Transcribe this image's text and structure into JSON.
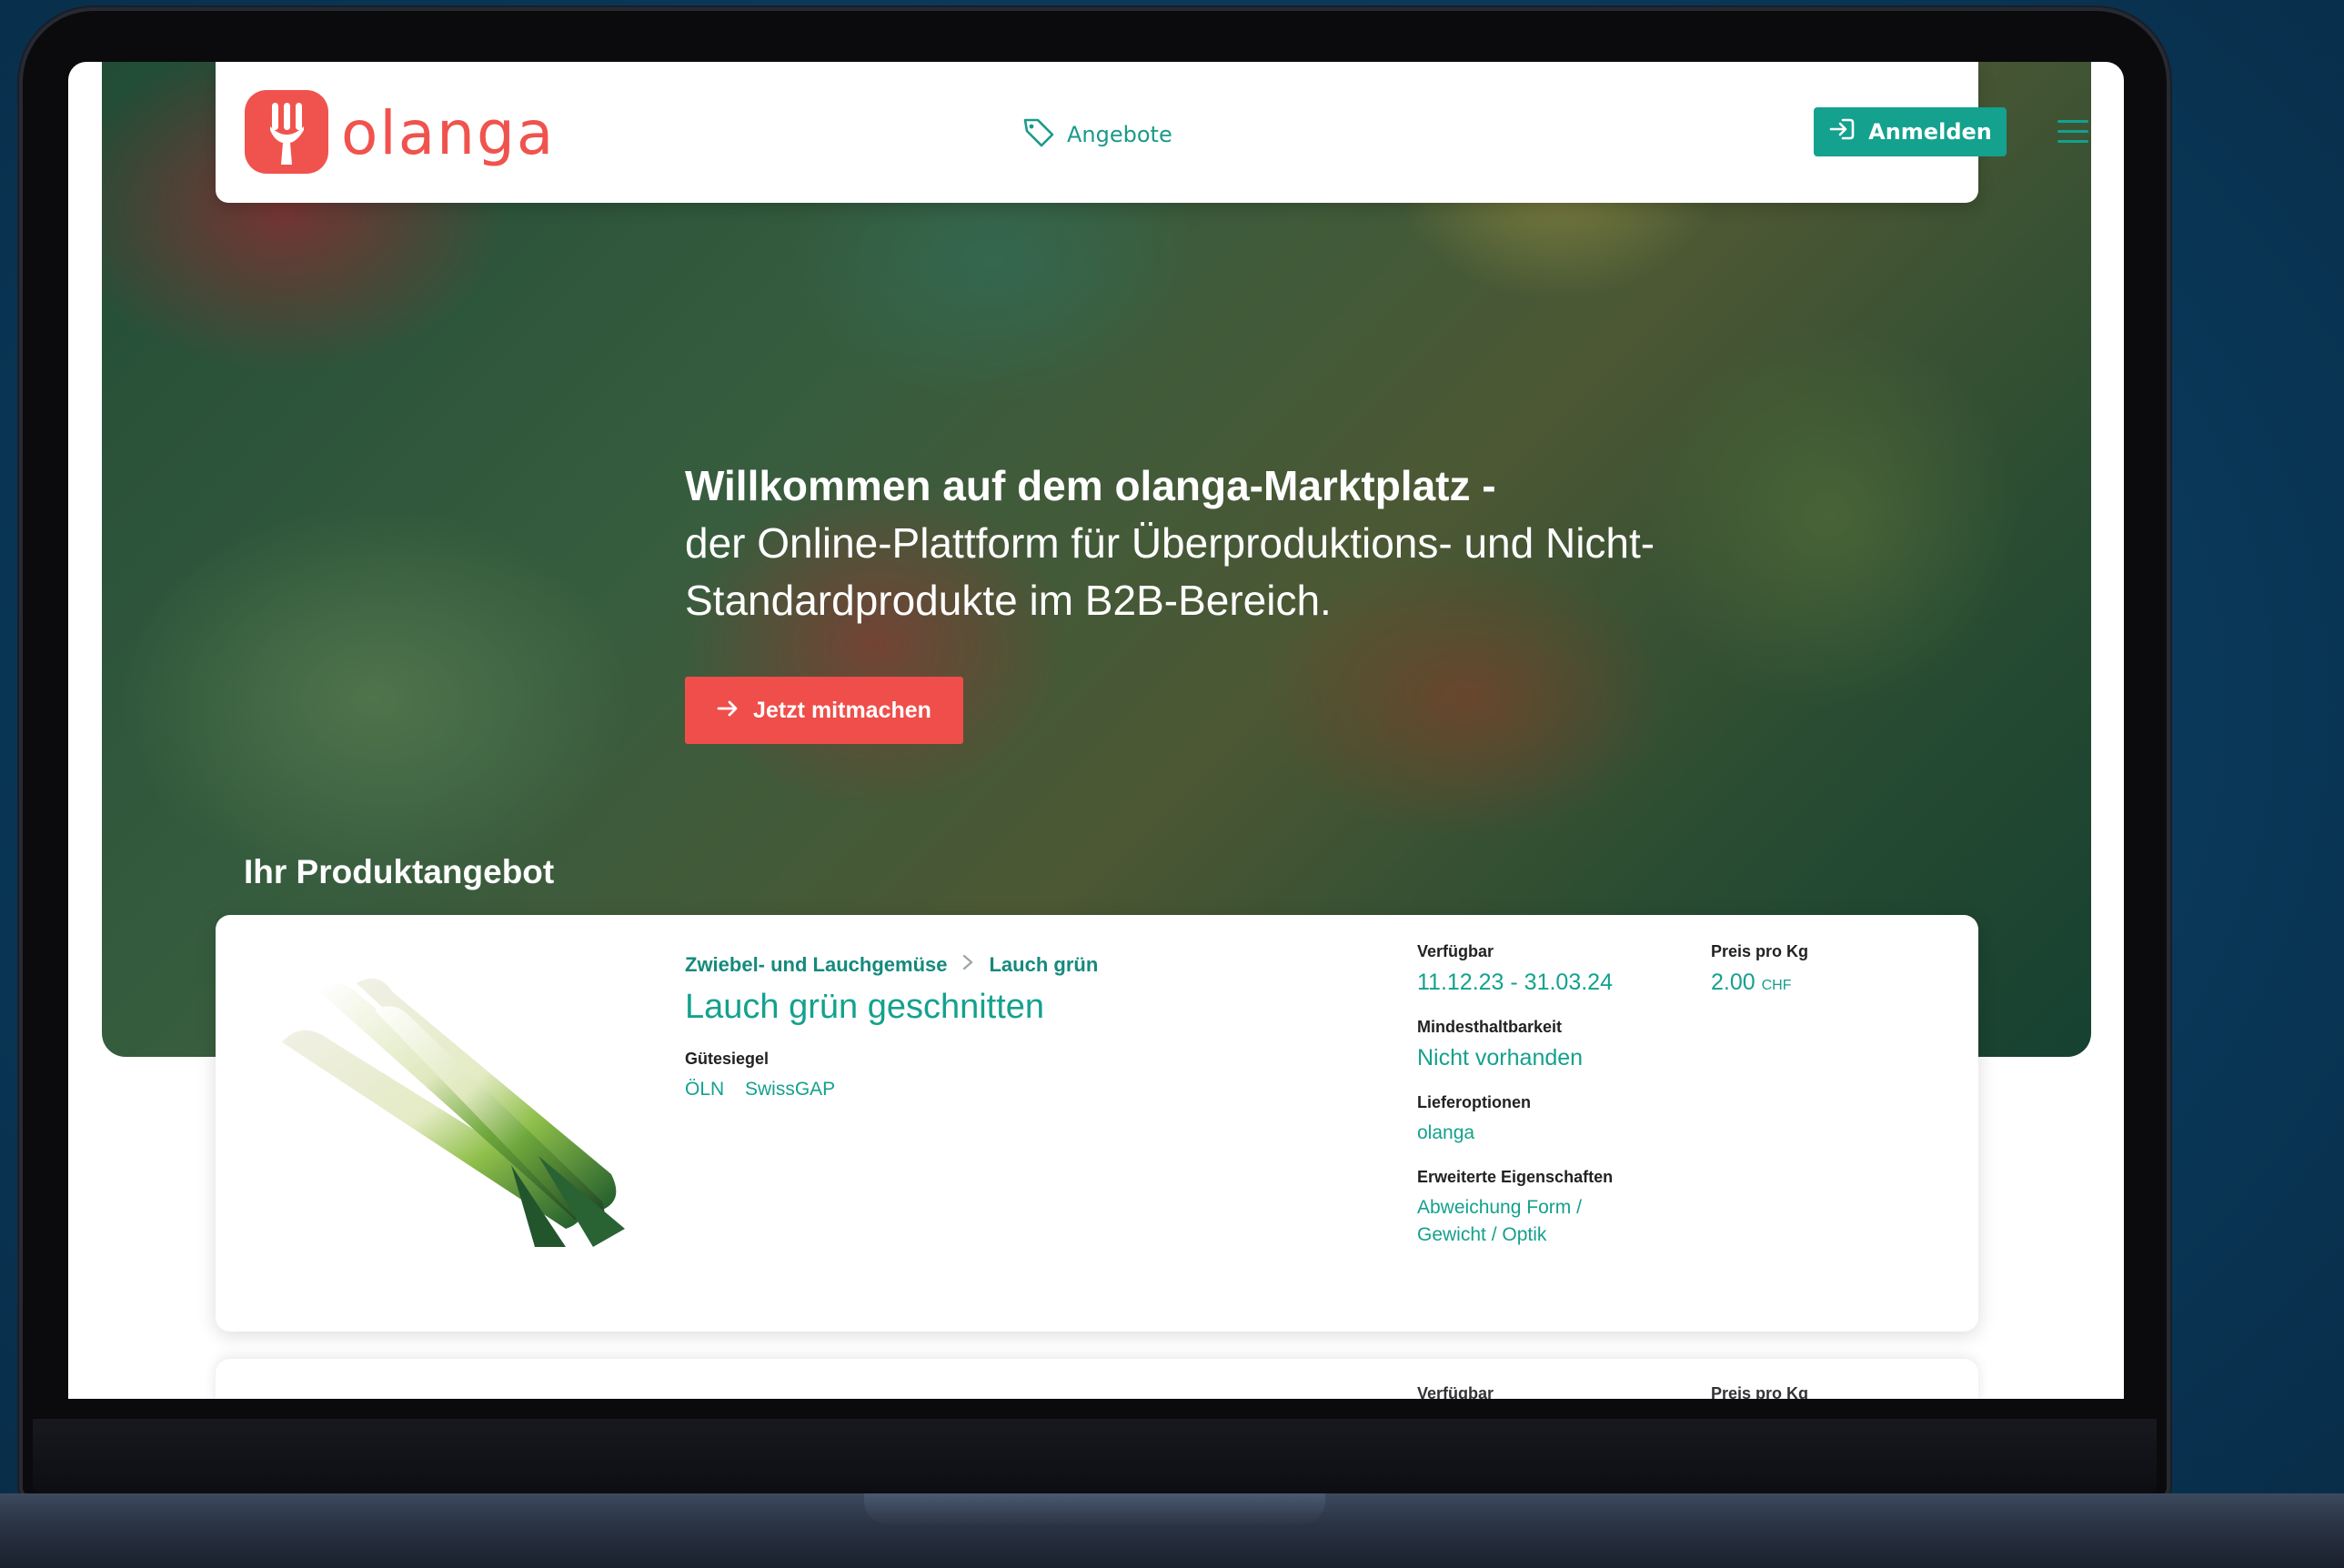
{
  "header": {
    "logo_text": "olanga",
    "nav_offers": "Angebote",
    "login_label": "Anmelden"
  },
  "hero": {
    "headline": "Willkommen auf dem olanga-Marktplatz -",
    "subline": "der Online-Plattform für Überproduktions- und Nicht-Standardprodukte im B2B-Bereich.",
    "cta_label": "Jetzt mitmachen"
  },
  "section": {
    "title": "Ihr Produktangebot"
  },
  "product": {
    "category": "Zwiebel- und Lauchgemüse",
    "subcategory": "Lauch grün",
    "title": "Lauch grün geschnitten",
    "seal_label": "Gütesiegel",
    "seals": [
      "ÖLN",
      "SwissGAP"
    ],
    "available_label": "Verfügbar",
    "available_value": "11.12.23 - 31.03.24",
    "price_label": "Preis pro Kg",
    "price_value": "2.00",
    "currency": "CHF",
    "mhd_label": "Mindesthaltbarkeit",
    "mhd_value": "Nicht vorhanden",
    "delivery_label": "Lieferoptionen",
    "delivery_value": "olanga",
    "extended_label": "Erweiterte Eigenschaften",
    "extended_value_line1": "Abweichung Form /",
    "extended_value_line2": "Gewicht / Optik"
  },
  "next_card": {
    "available_label": "Verfügbar",
    "price_label": "Preis pro Kg"
  },
  "colors": {
    "brand_red": "#f0534e",
    "teal": "#14a18e"
  }
}
